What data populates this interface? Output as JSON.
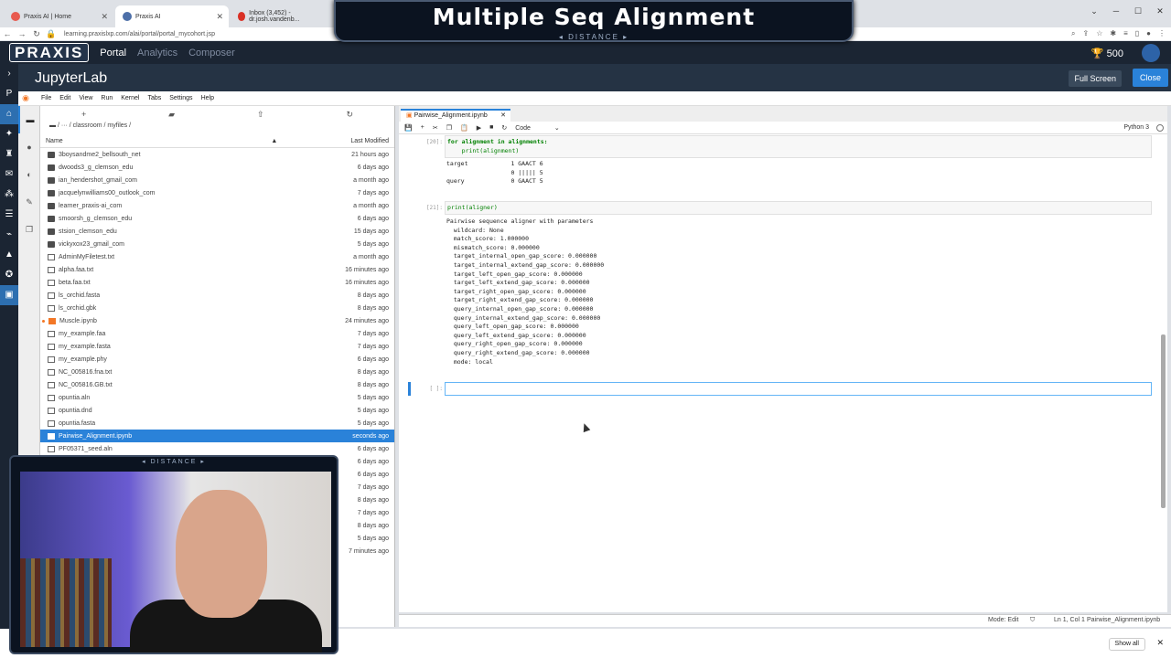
{
  "browser": {
    "tabs": [
      {
        "label": "Praxis AI | Home",
        "favicon_color": "#e85a4f"
      },
      {
        "label": "Praxis AI",
        "favicon_color": "#4d6fa8"
      },
      {
        "label": "Inbox (3,452) - dr.josh.vandenb...",
        "favicon_color": "#d93025"
      }
    ],
    "url": "learning.praxislxp.com/alai/portal/portal_mycohort.jsp"
  },
  "overlay": {
    "title": "Multiple Seq Alignment",
    "subtitle": "DISTANCE"
  },
  "praxis_nav": {
    "logo": "PRAXIS",
    "items": [
      "Portal",
      "Analytics",
      "Composer"
    ],
    "score": "500"
  },
  "jupyter": {
    "title": "JupyterLab",
    "full_screen_label": "Full Screen",
    "close_label": "Close",
    "menu": [
      "File",
      "Edit",
      "View",
      "Run",
      "Kernel",
      "Tabs",
      "Settings",
      "Help"
    ]
  },
  "file_browser": {
    "path": "/ ··· / classroom / myfiles /",
    "col_name": "Name",
    "col_modified": "Last Modified",
    "files": [
      {
        "name": "3boysandme2_bellsouth_net",
        "modified": "21 hours ago",
        "type": "folder"
      },
      {
        "name": "dwoods3_g_clemson_edu",
        "modified": "6 days ago",
        "type": "folder"
      },
      {
        "name": "ian_hendershot_gmail_com",
        "modified": "a month ago",
        "type": "folder"
      },
      {
        "name": "jacquelynwilliams00_outlook_com",
        "modified": "7 days ago",
        "type": "folder"
      },
      {
        "name": "learner_praxis-ai_com",
        "modified": "a month ago",
        "type": "folder"
      },
      {
        "name": "smoorsh_g_clemson_edu",
        "modified": "6 days ago",
        "type": "folder"
      },
      {
        "name": "stsion_clemson_edu",
        "modified": "15 days ago",
        "type": "folder"
      },
      {
        "name": "vickyxox23_gmail_com",
        "modified": "5 days ago",
        "type": "folder"
      },
      {
        "name": "AdminMyFiletest.txt",
        "modified": "a month ago",
        "type": "file"
      },
      {
        "name": "alpha.faa.txt",
        "modified": "16 minutes ago",
        "type": "file"
      },
      {
        "name": "beta.faa.txt",
        "modified": "16 minutes ago",
        "type": "file"
      },
      {
        "name": "ls_orchid.fasta",
        "modified": "8 days ago",
        "type": "file"
      },
      {
        "name": "ls_orchid.gbk",
        "modified": "8 days ago",
        "type": "file"
      },
      {
        "name": "Muscle.ipynb",
        "modified": "24 minutes ago",
        "type": "notebook",
        "running": true
      },
      {
        "name": "my_example.faa",
        "modified": "7 days ago",
        "type": "file"
      },
      {
        "name": "my_example.fasta",
        "modified": "7 days ago",
        "type": "file"
      },
      {
        "name": "my_example.phy",
        "modified": "6 days ago",
        "type": "file"
      },
      {
        "name": "NC_005816.fna.txt",
        "modified": "8 days ago",
        "type": "file"
      },
      {
        "name": "NC_005816.GB.txt",
        "modified": "8 days ago",
        "type": "file"
      },
      {
        "name": "opuntia.aln",
        "modified": "5 days ago",
        "type": "file"
      },
      {
        "name": "opuntia.dnd",
        "modified": "5 days ago",
        "type": "file"
      },
      {
        "name": "opuntia.fasta",
        "modified": "5 days ago",
        "type": "file"
      },
      {
        "name": "Pairwise_Alignment.ipynb",
        "modified": "seconds ago",
        "type": "notebook",
        "selected": true
      },
      {
        "name": "PF05371_seed.aln",
        "modified": "6 days ago",
        "type": "file"
      },
      {
        "name": "",
        "modified": "6 days ago",
        "type": "hidden"
      },
      {
        "name": "",
        "modified": "6 days ago",
        "type": "hidden"
      },
      {
        "name": "",
        "modified": "7 days ago",
        "type": "hidden"
      },
      {
        "name": "",
        "modified": "8 days ago",
        "type": "hidden"
      },
      {
        "name": "",
        "modified": "7 days ago",
        "type": "hidden"
      },
      {
        "name": "",
        "modified": "8 days ago",
        "type": "hidden"
      },
      {
        "name": "",
        "modified": "5 days ago",
        "type": "hidden"
      },
      {
        "name": "",
        "modified": "7 minutes ago",
        "type": "hidden"
      }
    ]
  },
  "notebook": {
    "tab_label": "Pairwise_Alignment.ipynb",
    "cell_type": "Code",
    "kernel": "Python 3",
    "cell20_prompt": "[20]:",
    "cell20_code_line1": "for alignment in alignments:",
    "cell20_code_line2": "    print(alignment)",
    "cell20_output": "target            1 GAACT 6\n                  0 ||||| 5\nquery             0 GAACT 5",
    "cell21_prompt": "[21]:",
    "cell21_code": "print(aligner)",
    "cell21_output": "Pairwise sequence aligner with parameters\n  wildcard: None\n  match_score: 1.000000\n  mismatch_score: 0.000000\n  target_internal_open_gap_score: 0.000000\n  target_internal_extend_gap_score: 0.000000\n  target_left_open_gap_score: 0.000000\n  target_left_extend_gap_score: 0.000000\n  target_right_open_gap_score: 0.000000\n  target_right_extend_gap_score: 0.000000\n  query_internal_open_gap_score: 0.000000\n  query_internal_extend_gap_score: 0.000000\n  query_left_open_gap_score: 0.000000\n  query_left_extend_gap_score: 0.000000\n  query_right_open_gap_score: 0.000000\n  query_right_extend_gap_score: 0.000000\n  mode: local",
    "empty_prompt": "[ ]:"
  },
  "status_bar": {
    "mode": "Mode: Edit",
    "position": "Ln 1, Col 1",
    "file": "Pairwise_Alignment.ipynb"
  },
  "bottom": {
    "show_all": "Show all"
  },
  "webcam": {
    "subtitle": "DISTANCE"
  }
}
